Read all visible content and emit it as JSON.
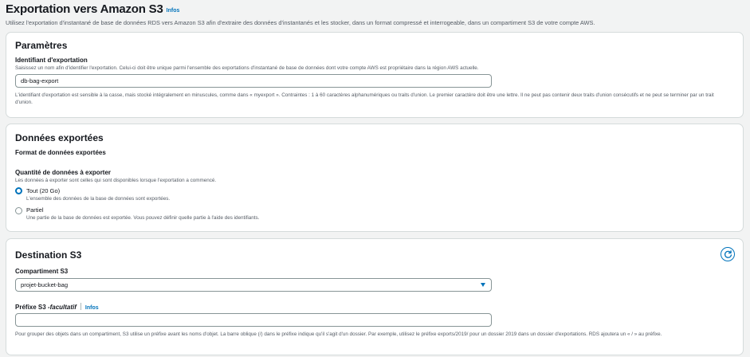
{
  "header": {
    "title": "Exportation vers Amazon S3",
    "info": "Infos",
    "description": "Utilisez l'exportation d'instantané de base de données RDS vers Amazon S3 afin d'extraire des données d'instantanés et les stocker, dans un format compressé et interrogeable, dans un compartiment S3 de votre compte AWS."
  },
  "params": {
    "title": "Paramètres",
    "export_id_label": "Identifiant d'exportation",
    "export_id_hint": "Saisissez un nom afin d'identifier l'exportation. Celui-ci doit être unique parmi l'ensemble des exportations d'instantané de base de données dont votre compte AWS est propriétaire dans la région AWS actuelle.",
    "export_id_value": "db-bag-export",
    "export_id_constraints": "L'identifiant d'exportation est sensible à la casse, mais stocké intégralement en minuscules, comme dans « myexport ». Contraintes : 1 à 60 caractères alphanumériques ou traits d'union. Le premier caractère doit être une lettre. Il ne peut pas contenir deux traits d'union consécutifs et ne peut se terminer par un trait d'union."
  },
  "data": {
    "title": "Données exportées",
    "format_label": "Format de données exportées",
    "quantity_label": "Quantité de données à exporter",
    "quantity_hint": "Les données à exporter sont celles qui sont disponibles lorsque l'exportation a commencé.",
    "options": [
      {
        "label": "Tout (20 Go)",
        "desc": "L'ensemble des données de la base de données sont exportées.",
        "selected": true
      },
      {
        "label": "Partiel",
        "desc": "Une partie de la base de données est exportée. Vous pouvez définir quelle partie à l'aide des identifiants.",
        "selected": false
      }
    ]
  },
  "destination": {
    "title": "Destination S3",
    "bucket_label": "Compartiment S3",
    "bucket_value": "projet-bucket-bag",
    "prefix_label": "Préfixe S3 ",
    "prefix_optional": "-facultatif",
    "prefix_info": "Infos",
    "prefix_value": "",
    "prefix_hint": "Pour grouper des objets dans un compartiment, S3 utilise un préfixe avant les noms d'objet. La barre oblique (/) dans le préfixe indique qu'il s'agit d'un dossier. Par exemple, utilisez le préfixe exports/2019/ pour un dossier 2019 dans un dossier d'exportations. RDS ajoutera un « / » au préfixe."
  },
  "colors": {
    "accent": "#0073bb",
    "background": "#f2f3f3",
    "border": "#d5dbdb"
  },
  "icons": {
    "refresh": "refresh-icon",
    "caret": "caret-down-icon"
  }
}
